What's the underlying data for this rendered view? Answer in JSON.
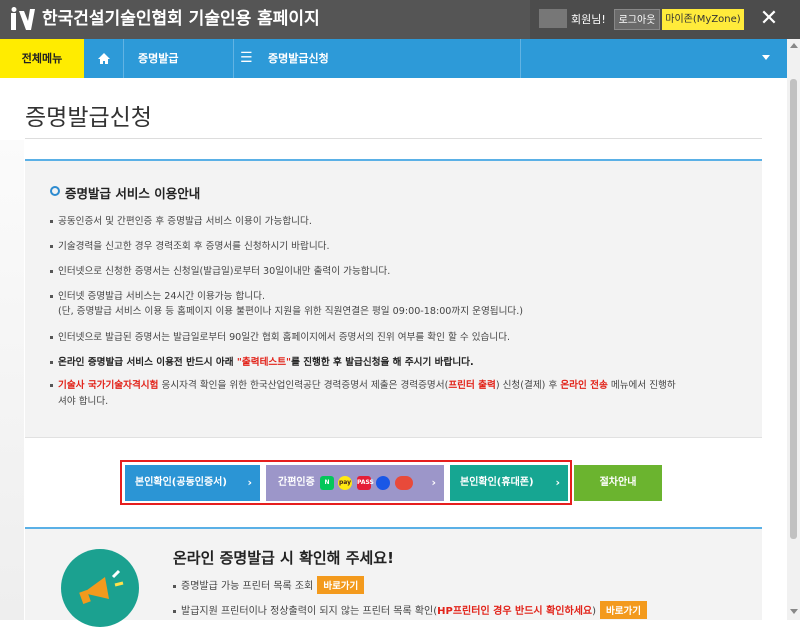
{
  "window": {
    "title": "한국건설기술인협회 기술인용 홈페이지",
    "greeting": "회원님!",
    "logout_label": "로그아웃",
    "myzone_label": "마이존(MyZone)",
    "close_label": "✕"
  },
  "nav": {
    "all_menu": "전체메뉴",
    "item1": "증명발급",
    "item2": "증명발급신청"
  },
  "page": {
    "title": "증명발급신청"
  },
  "notice": {
    "heading": "증명발급 서비스 이용안내",
    "items": [
      "공동인증서 및 간편인증 후 증명발급 서비스 이용이 가능합니다.",
      "기술경력을 신고한 경우 경력조회 후 증명서를 신청하시기 바랍니다.",
      "인터넷으로 신청한 증명서는 신청일(발급일)로부터 30일이내만 출력이 가능합니다.",
      "인터넷 증명발급 서비스는 24시간 이용가능 합니다.",
      "(단, 증명발급 서비스 이용 등 홈페이지 이용 불편이나 지원을 위한 직원연결은 평일 09:00-18:00까지 운영됩니다.)",
      "인터넷으로 발급된 증명서는 발급일로부터 90일간 협회 홈페이지에서 증명서의 진위 여부를 확인 할 수 있습니다."
    ],
    "bold_item_pre": "온라인 증명발급 서비스 이용전 반드시 아래 ",
    "bold_item_red": "\"출력테스트\"",
    "bold_item_post": "를 진행한 후 발급신청을 해 주시기 바랍니다.",
    "last_item_red1": "기술사 국가기술자격시험",
    "last_item_mid1": " 응시자격 확인을 위한 한국산업인력공단 경력증명서 제출은 경력증명서(",
    "last_item_red2": "프린터 출력",
    "last_item_mid2": ") 신청(결제) 후 ",
    "last_item_red3": "온라인 전송",
    "last_item_mid3": " 메뉴에서 진행하",
    "last_item_line2": "셔야 합니다."
  },
  "actions": {
    "cert_btn": "본인확인(공동인증서)",
    "simple_btn": "간편인증",
    "phone_btn": "본인확인(휴대폰)",
    "guide_btn": "절차안내",
    "chevron": "›",
    "pay_icons": [
      {
        "label": "N",
        "color": "#03c75a",
        "text_color": "#ffffff"
      },
      {
        "label": "pay",
        "color": "#ffe812",
        "text_color": "#3c1e1e"
      },
      {
        "label": "PASS",
        "color": "#e51d37",
        "text_color": "#ffffff"
      },
      {
        "label": "",
        "color": "#1a57e6",
        "text_color": "#ffffff"
      },
      {
        "label": "",
        "color": "#e84a3a",
        "text_color": "#ffffff"
      }
    ]
  },
  "lower": {
    "heading": "온라인 증명발급 시 확인해 주세요!",
    "item1": "증명발급 가능 프린터 목록 조회",
    "item2_pre": "발급지원 프린터이나 정상출력이 되지 않는 프린터 목록 확인(",
    "item2_red": "HP프린터인 경우 반드시 확인하세요",
    "item2_post": ")",
    "go_label": "바로가기"
  },
  "colors": {
    "accent": "#2d9ad8",
    "highlight": "#ffec00",
    "alert_red": "#e2231a"
  }
}
